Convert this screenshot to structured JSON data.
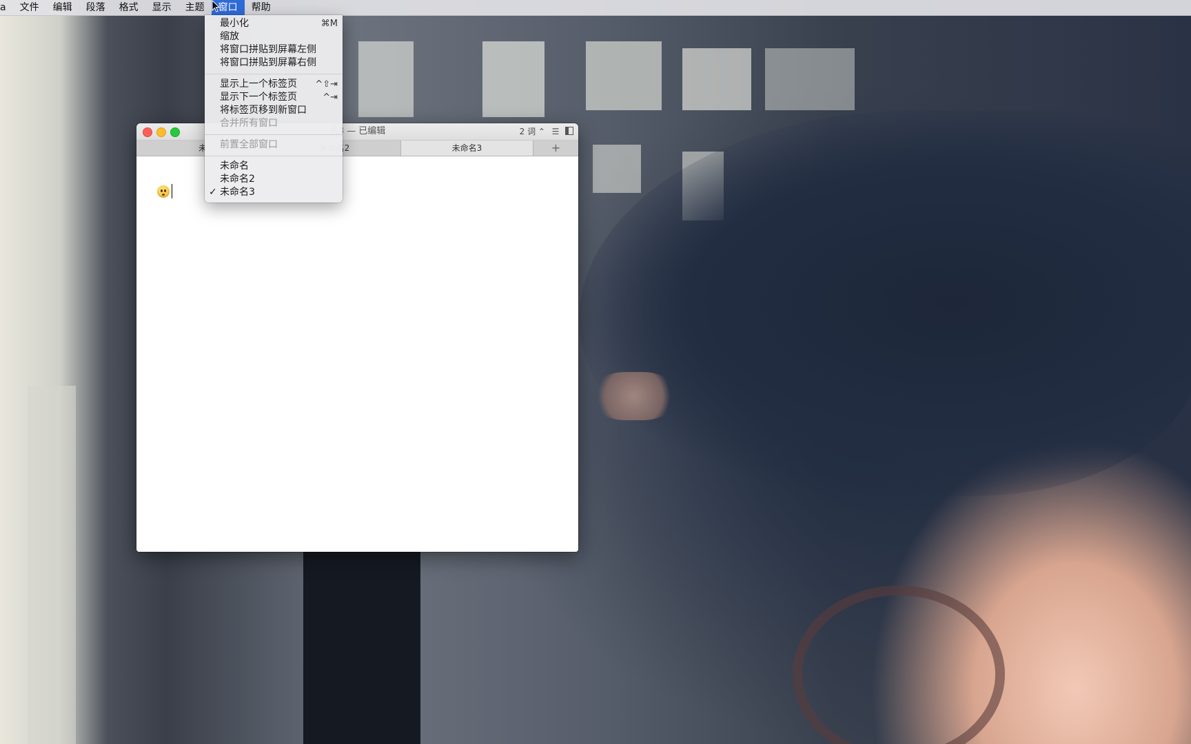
{
  "menubar": {
    "app_fragment": "a",
    "items": [
      "文件",
      "编辑",
      "段落",
      "格式",
      "显示",
      "主题",
      "窗口",
      "帮助"
    ],
    "active_index": 6
  },
  "window_menu": {
    "group1": [
      {
        "label": "最小化",
        "shortcut": "⌘M",
        "enabled": true
      },
      {
        "label": "缩放",
        "shortcut": "",
        "enabled": true
      },
      {
        "label": "将窗口拼贴到屏幕左侧",
        "shortcut": "",
        "enabled": true
      },
      {
        "label": "将窗口拼贴到屏幕右侧",
        "shortcut": "",
        "enabled": true
      }
    ],
    "group2": [
      {
        "label": "显示上一个标签页",
        "shortcut": "^⇧⇥",
        "enabled": true
      },
      {
        "label": "显示下一个标签页",
        "shortcut": "^⇥",
        "enabled": true
      },
      {
        "label": "将标签页移到新窗口",
        "shortcut": "",
        "enabled": true
      },
      {
        "label": "合并所有窗口",
        "shortcut": "",
        "enabled": false
      }
    ],
    "group3": [
      {
        "label": "前置全部窗口",
        "shortcut": "",
        "enabled": false
      }
    ],
    "group4": [
      {
        "label": "未命名",
        "checked": false
      },
      {
        "label": "未命名2",
        "checked": false
      },
      {
        "label": "未命名3",
        "checked": true
      }
    ],
    "checkmark": "✓"
  },
  "window": {
    "title": "未命名3 — 已编辑",
    "title_visible": "名3 — 已编辑",
    "word_count": "2 词 ⌃",
    "tabs": [
      {
        "label": "未命名",
        "label_visible": "未"
      },
      {
        "label": "未命名2"
      },
      {
        "label": "未命名3",
        "active": true
      }
    ],
    "add_tab": "+",
    "document_emoji": "hushed-face-emoji"
  },
  "colors": {
    "menu_highlight": "#2f6bd8",
    "close": "#fc5f57",
    "minimize": "#fdbc2e",
    "maximize": "#28c840"
  }
}
